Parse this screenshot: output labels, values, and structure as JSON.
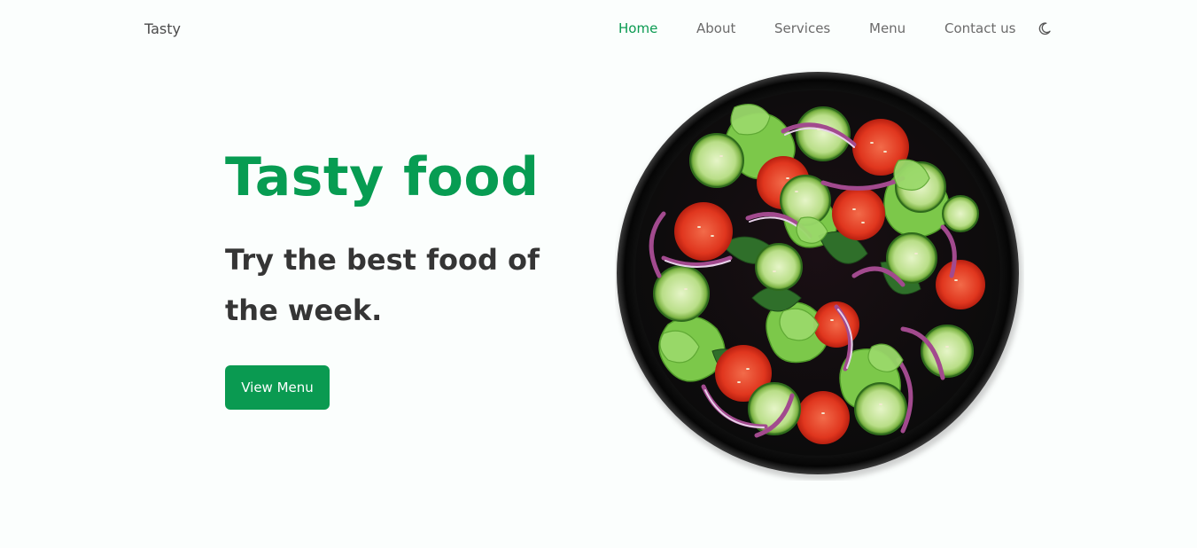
{
  "header": {
    "logo": "Tasty",
    "nav": [
      {
        "label": "Home",
        "active": true
      },
      {
        "label": "About"
      },
      {
        "label": "Services"
      },
      {
        "label": "Menu"
      },
      {
        "label": "Contact us"
      }
    ],
    "theme_icon": "moon-icon"
  },
  "hero": {
    "title": "Tasty food",
    "subtitle": "Try the best food of the week.",
    "button_label": "View Menu",
    "image": "salad-bowl-image"
  },
  "colors": {
    "accent": "#0a9a51",
    "heading": "#353535",
    "nav_text": "#6b6b6b",
    "background": "#fbfefd"
  }
}
